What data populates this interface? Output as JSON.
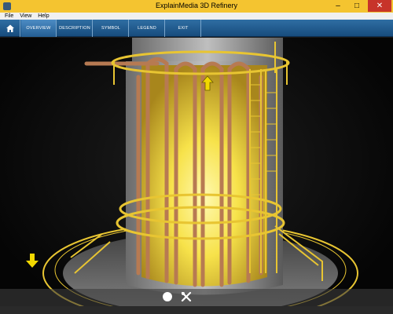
{
  "window": {
    "title": "ExplainMedia 3D Refinery",
    "minimize": "–",
    "maximize": "□",
    "close": "✕"
  },
  "menu": {
    "items": [
      "File",
      "View",
      "Help"
    ]
  },
  "nav": {
    "tabs": [
      "OVERVIEW",
      "DESCRIPTION",
      "SYMBOL",
      "LEGEND",
      "EXIT"
    ],
    "active": "OVERVIEW"
  },
  "colors": {
    "titlebar": "#f4c430",
    "nav": "#1f5c93",
    "structure_yellow": "#e8c532",
    "glow": "#fff06a",
    "pipe": "#b77a52"
  },
  "icons": {
    "home": "home-icon",
    "up": "up-arrow-icon",
    "down": "down-arrow-icon",
    "dot": "circle-icon",
    "tool": "tools-icon"
  }
}
